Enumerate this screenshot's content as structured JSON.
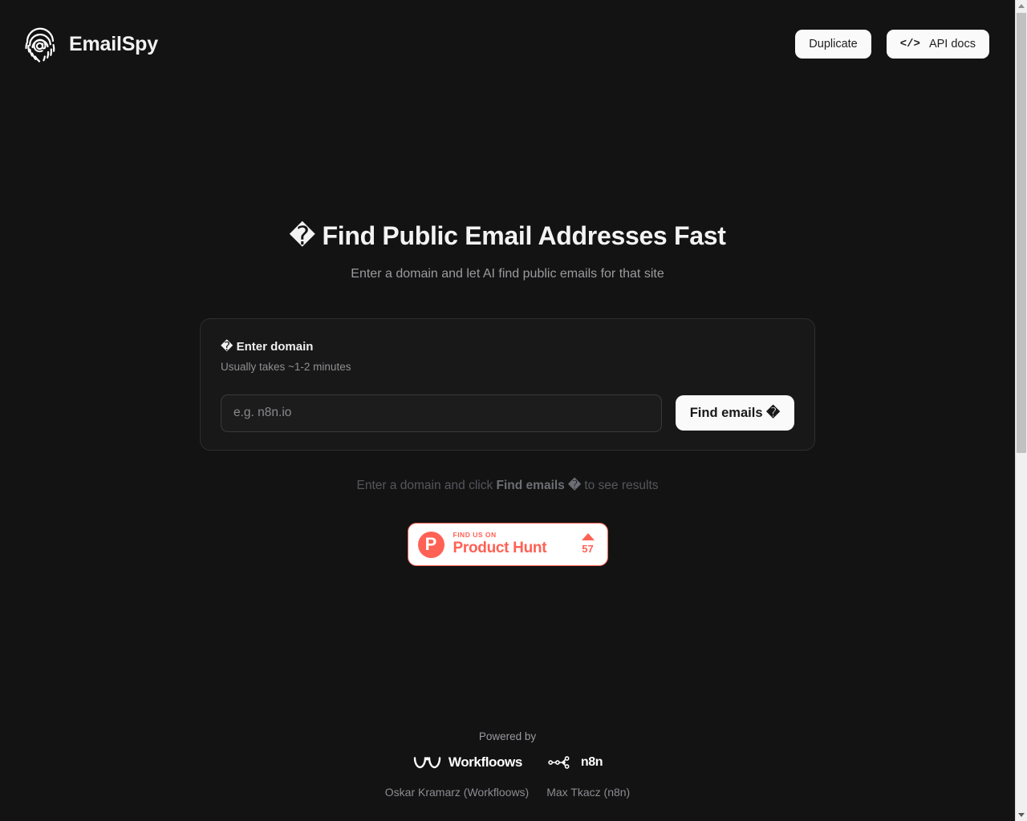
{
  "header": {
    "logo_icon": "fingerprint-at-icon",
    "brand_name": "EmailSpy",
    "duplicate_label": "Duplicate",
    "api_docs_label": "API docs",
    "api_docs_icon": "code-icon",
    "api_docs_icon_glyph": "</>"
  },
  "hero": {
    "title_icon": "�",
    "title": "Find Public Email Addresses Fast",
    "subtitle": "Enter a domain and let AI find public emails for that site"
  },
  "form_card": {
    "title_icon": "�",
    "title": "Enter domain",
    "subtitle": "Usually takes ~1-2 minutes",
    "input_value": "",
    "input_placeholder": "e.g. n8n.io",
    "submit_label": "Find emails �"
  },
  "status": {
    "hint_prefix": "Enter a domain and click ",
    "hint_strong": "Find emails �",
    "hint_suffix": " to see results"
  },
  "product_hunt": {
    "logo_letter": "P",
    "kicker": "FIND US ON",
    "name": "Product Hunt",
    "upvote_icon": "triangle-up-icon",
    "votes": "57",
    "accent_color": "#ff6154"
  },
  "footer": {
    "powered_by": "Powered by",
    "logos": [
      {
        "icon": "workfloows-logo-icon",
        "label": "Workfloows"
      },
      {
        "icon": "n8n-logo-icon",
        "label": "n8n"
      }
    ],
    "credits": [
      "Oskar Kramarz (Workfloows)",
      "Max Tkacz (n8n)"
    ]
  },
  "scrollbar": {
    "up_arrow_icon": "scroll-up-arrow-icon",
    "down_arrow_icon": "scroll-down-arrow-icon"
  },
  "theme": {
    "background": "#131313",
    "card_background": "#181818",
    "accent_button": "#fafafa",
    "brand_accent": "#ff6154"
  }
}
